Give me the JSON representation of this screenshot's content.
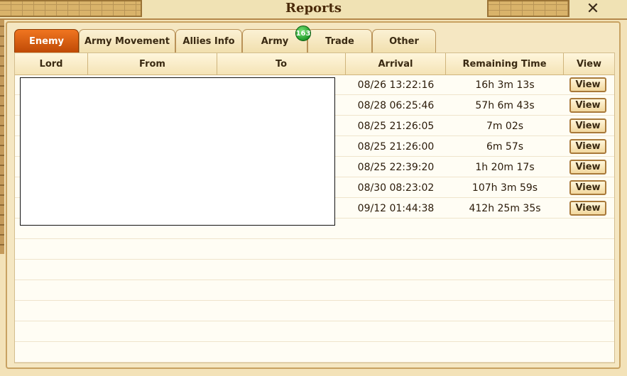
{
  "window": {
    "title": "Reports"
  },
  "tabs": [
    {
      "label": "Enemy",
      "active": true
    },
    {
      "label": "Army Movement",
      "active": false
    },
    {
      "label": "Allies Info",
      "active": false
    },
    {
      "label": "Army",
      "active": false,
      "badge": "163"
    },
    {
      "label": "Trade",
      "active": false
    },
    {
      "label": "Other",
      "active": false
    }
  ],
  "table": {
    "columns": [
      "Lord",
      "From",
      "To",
      "Arrival",
      "Remaining Time",
      "View"
    ],
    "rows": [
      {
        "arrival": "08/26 13:22:16",
        "remaining": "16h 3m 13s",
        "view": "View"
      },
      {
        "arrival": "08/28 06:25:46",
        "remaining": "57h 6m 43s",
        "view": "View"
      },
      {
        "arrival": "08/25 21:26:05",
        "remaining": "7m 02s",
        "view": "View"
      },
      {
        "arrival": "08/25 21:26:00",
        "remaining": "6m 57s",
        "view": "View"
      },
      {
        "arrival": "08/25 22:39:20",
        "remaining": "1h 20m 17s",
        "view": "View"
      },
      {
        "arrival": "08/30 08:23:02",
        "remaining": "107h 3m 59s",
        "view": "View"
      },
      {
        "arrival": "09/12 01:44:38",
        "remaining": "412h 25m 35s",
        "view": "View"
      }
    ]
  },
  "colors": {
    "active_tab": "#e0650f",
    "badge": "#1f9a2a"
  }
}
